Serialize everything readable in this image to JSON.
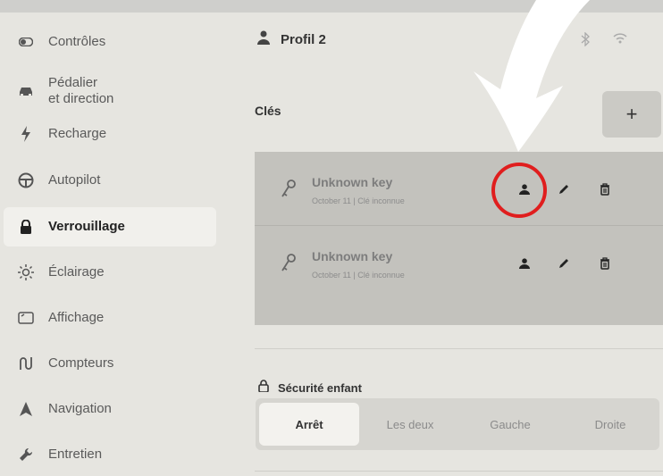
{
  "sidebar": {
    "items": [
      {
        "label": "Contrôles",
        "icon": "toggle-icon"
      },
      {
        "label": "Pédalier\net direction",
        "icon": "car-icon"
      },
      {
        "label": "Recharge",
        "icon": "bolt-icon"
      },
      {
        "label": "Autopilot",
        "icon": "steering-wheel-icon"
      },
      {
        "label": "Verrouillage",
        "icon": "lock-icon"
      },
      {
        "label": "Éclairage",
        "icon": "sun-icon"
      },
      {
        "label": "Affichage",
        "icon": "display-icon"
      },
      {
        "label": "Compteurs",
        "icon": "odometer-icon"
      },
      {
        "label": "Navigation",
        "icon": "navigation-arrow-icon"
      },
      {
        "label": "Entretien",
        "icon": "wrench-icon"
      }
    ],
    "active": "Verrouillage"
  },
  "header": {
    "profile_label": "Profil 2"
  },
  "keys": {
    "title": "Clés",
    "add_label": "+",
    "items": [
      {
        "name": "Unknown key",
        "sub": "October 11 | Clé inconnue"
      },
      {
        "name": "Unknown key",
        "sub": "October 11 | Clé inconnue"
      }
    ]
  },
  "child_safety": {
    "title": "Sécurité enfant",
    "options": [
      "Arrêt",
      "Les deux",
      "Gauche",
      "Droite"
    ],
    "selected": "Arrêt"
  },
  "colors": {
    "annotation": "#e01e1e",
    "active_bg": "#f1f0ec",
    "panel_bg": "#c3c2bd"
  }
}
